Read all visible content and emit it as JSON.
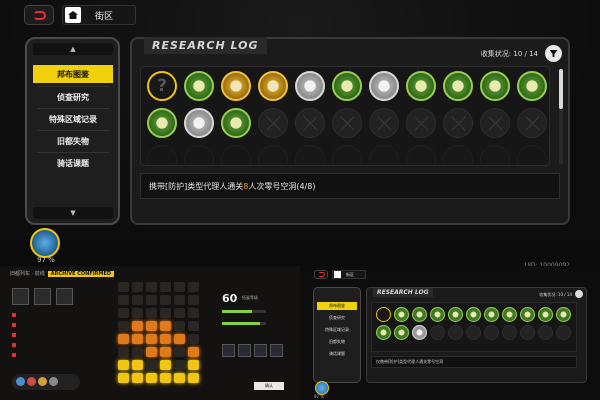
{
  "header": {
    "title": "街区"
  },
  "menu": {
    "items": [
      {
        "label": "邦布图鉴",
        "active": true
      },
      {
        "label": "侦查研究",
        "active": false
      },
      {
        "label": "特殊区域记录",
        "active": false
      },
      {
        "label": "旧都失物",
        "active": false
      },
      {
        "label": "骑话课题",
        "active": false
      }
    ]
  },
  "panel": {
    "title": "RESEARCH LOG",
    "collect_label": "收集状况: ",
    "collect_value": "10 / 14",
    "description_pre": "携带[防护]类型代理人通关",
    "description_highlight": "8",
    "description_post": "人次零号空洞(4/8)"
  },
  "badges": [
    "unknown",
    "green",
    "gold",
    "gold",
    "silver",
    "green",
    "silver",
    "green",
    "green",
    "green",
    "green",
    "green",
    "silver",
    "green",
    "empty",
    "empty",
    "empty",
    "empty",
    "empty",
    "empty",
    "empty",
    "empty",
    "faded",
    "faded",
    "faded",
    "faded",
    "faded",
    "faded",
    "faded",
    "faded",
    "faded",
    "faded",
    "faded"
  ],
  "player": {
    "percent": "97 %",
    "uid": "UID: 10009092"
  },
  "bottom_left": {
    "crumb": "旧都列车 · 前线",
    "crumb_tag": "ARCHIVE CONFIRMED",
    "level": "60",
    "level_label": "拓展等级",
    "confirm": "确认"
  },
  "bottom_right": {
    "home_label": "街区",
    "title": "RESEARCH LOG",
    "collect": "收集状况: 10 / 14",
    "menu": [
      "邦布图鉴",
      "侦查研究",
      "特殊区域记录",
      "旧都失物",
      "骑话课题"
    ],
    "description": "仅携带[防护]类型代理人通关零号空洞",
    "percent": "97 %",
    "badges": [
      "unknown",
      "green",
      "green",
      "green",
      "green",
      "green",
      "green",
      "green",
      "green",
      "green",
      "green",
      "green",
      "green",
      "silver",
      "empty",
      "empty",
      "empty",
      "empty",
      "empty",
      "empty",
      "empty",
      "empty"
    ]
  }
}
